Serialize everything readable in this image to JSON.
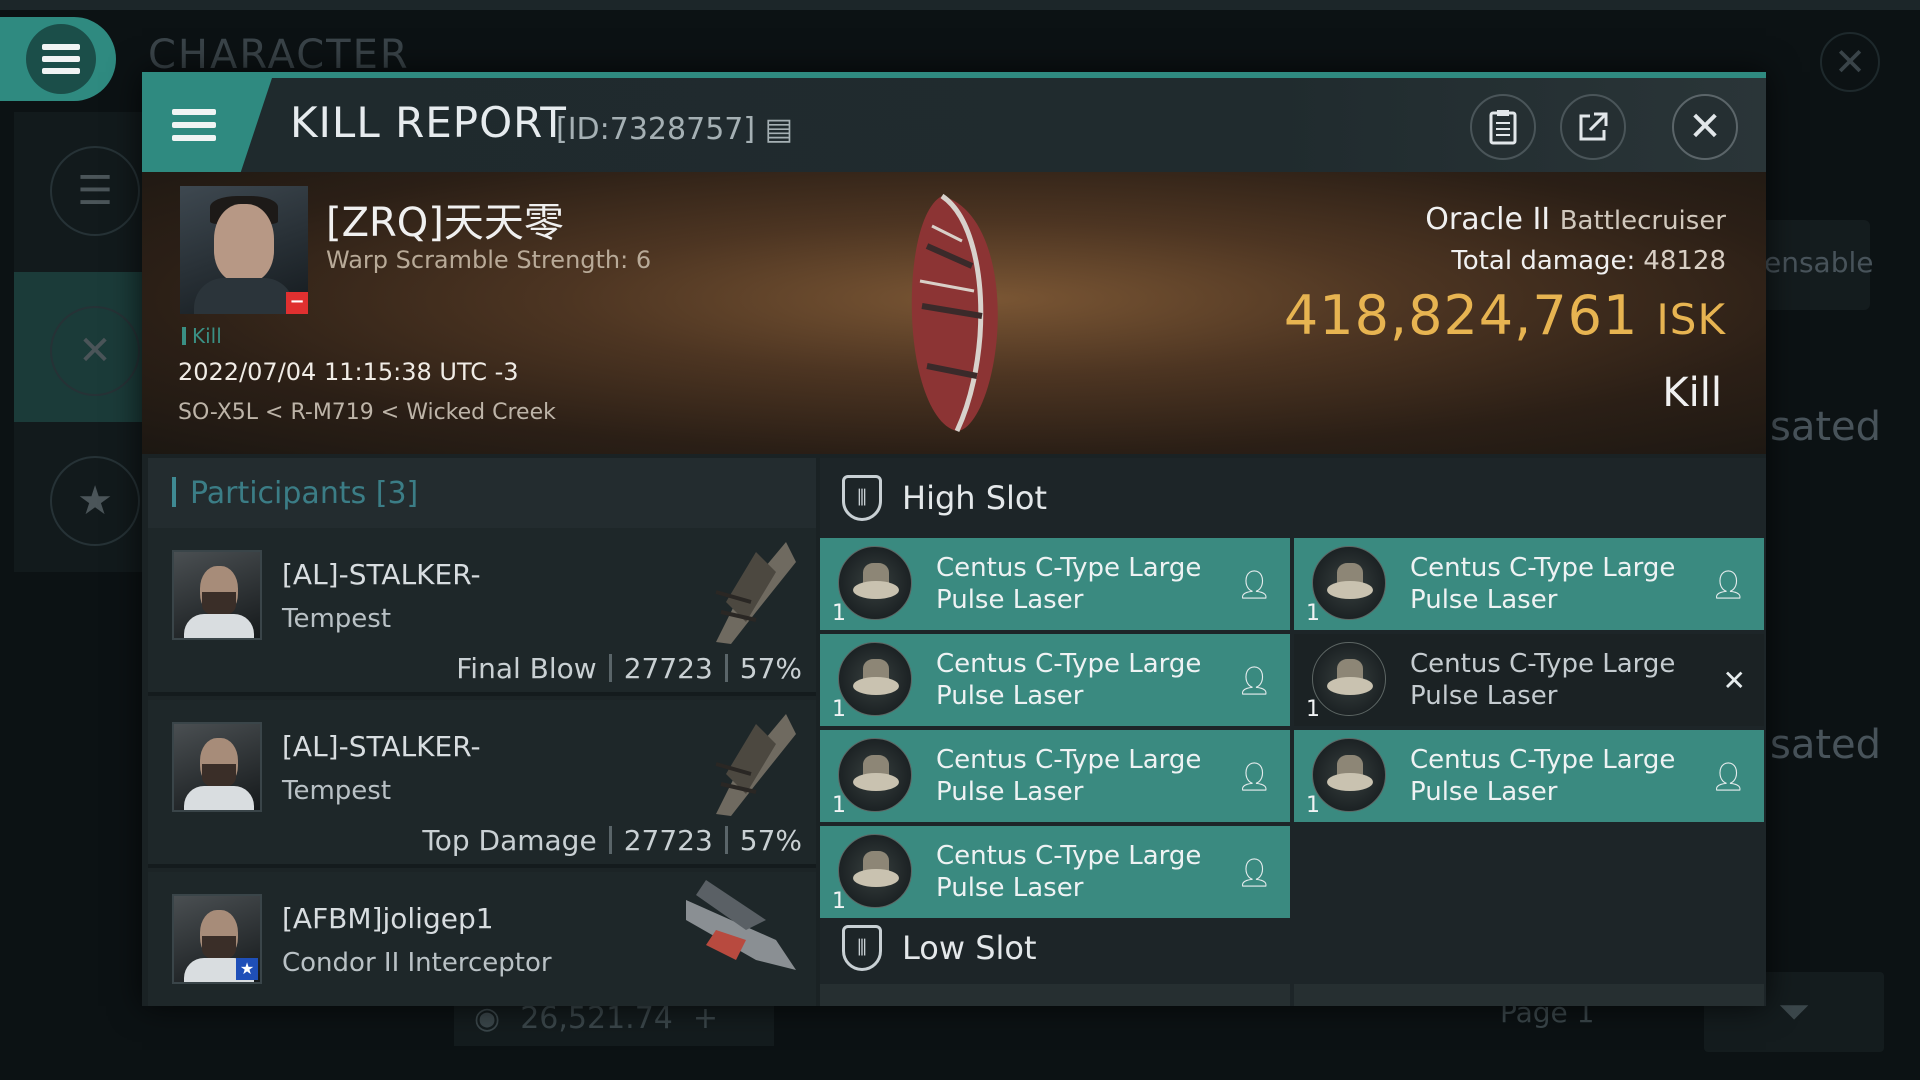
{
  "background": {
    "title": "CHARACTER",
    "right_texts": [
      "ensable",
      "sated",
      "sated"
    ],
    "balance": "26,521.74",
    "page": "Page 1"
  },
  "header": {
    "title": "KILL REPORT",
    "id": "[ID:7328757]"
  },
  "victim": {
    "name": "[ZRQ]天天零",
    "subtitle": "Warp Scramble Strength: 6",
    "tag": "Kill",
    "datetime": "2022/07/04 11:15:38 UTC -3",
    "location": "SO-X5L < R-M719 < Wicked Creek",
    "ship": "Oracle II",
    "ship_class": "Battlecruiser",
    "total_damage_label": "Total damage:",
    "total_damage": "48128",
    "isk_value": "418,824,761",
    "isk_unit": "ISK",
    "result": "Kill"
  },
  "participants": {
    "heading": "Participants [3]",
    "rows": [
      {
        "name": "[AL]-STALKER-",
        "ship": "Tempest",
        "role": "Final Blow",
        "damage": "27723",
        "percent": "57%"
      },
      {
        "name": "[AL]-STALKER-",
        "ship": "Tempest",
        "role": "Top Damage",
        "damage": "27723",
        "percent": "57%"
      },
      {
        "name": "[AFBM]joligep1",
        "ship": "Condor II Interceptor",
        "role": "",
        "damage": "",
        "percent": ""
      }
    ]
  },
  "slots": {
    "high": {
      "label": "High Slot",
      "modules": [
        {
          "name": "Centus C-Type Large Pulse Laser",
          "qty": "1",
          "status": "person-icon"
        },
        {
          "name": "Centus C-Type Large Pulse Laser",
          "qty": "1",
          "status": "person-icon"
        },
        {
          "name": "Centus C-Type Large Pulse Laser",
          "qty": "1",
          "status": "person-icon"
        },
        {
          "name": "Centus C-Type Large Pulse Laser",
          "qty": "1",
          "status": "close-icon"
        },
        {
          "name": "Centus C-Type Large Pulse Laser",
          "qty": "1",
          "status": "person-icon"
        },
        {
          "name": "Centus C-Type Large Pulse Laser",
          "qty": "1",
          "status": "person-icon"
        },
        {
          "name": "Centus C-Type Large Pulse Laser",
          "qty": "1",
          "status": "person-icon"
        }
      ]
    },
    "low": {
      "label": "Low Slot"
    }
  },
  "colors": {
    "accent": "#2f8a80",
    "isk": "#e7b451",
    "module_dropped": "#3a8a80"
  }
}
